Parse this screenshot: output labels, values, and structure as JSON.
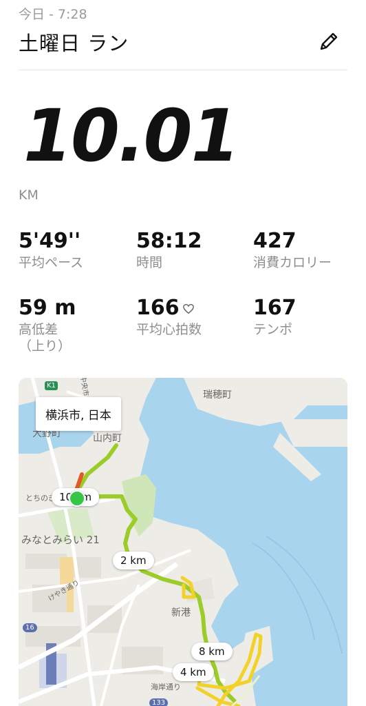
{
  "header": {
    "date": "今日 - 7:28",
    "title": "土曜日 ラン"
  },
  "summary": {
    "distance": "10.01",
    "unit": "KM"
  },
  "stats": [
    {
      "value": "5'49''",
      "label": "平均ペース"
    },
    {
      "value": "58:12",
      "label": "時間"
    },
    {
      "value": "427",
      "label": "消費カロリー"
    },
    {
      "value": "59 m",
      "label": "高低差\n（上り）"
    },
    {
      "value": "166",
      "label": "平均心拍数"
    },
    {
      "value": "167",
      "label": "テンポ"
    }
  ],
  "map": {
    "location": "横浜市, 日本",
    "places": {
      "mizuho": "瑞穂町",
      "ohno": "大野町",
      "sannai": "山内町",
      "minatomirai": "みなとみらい 21",
      "shinko": "新港",
      "tochinoki": "とちのき",
      "keyaki": "けやき通り",
      "kaigan": "海岸通り",
      "chuo": "中央市"
    },
    "road_badges": {
      "k1": "K1",
      "r16": "16",
      "r133": "133"
    },
    "km_markers": {
      "m10": "10 km",
      "m2": "2 km",
      "m8": "8 km",
      "m4": "4 km"
    },
    "colors": {
      "water": "#a9d4ee",
      "land": "#eeece6",
      "route_green": "#9ccc2a",
      "route_yellow": "#f2d22a",
      "route_red": "#e05a2a",
      "start": "#37c646"
    }
  }
}
